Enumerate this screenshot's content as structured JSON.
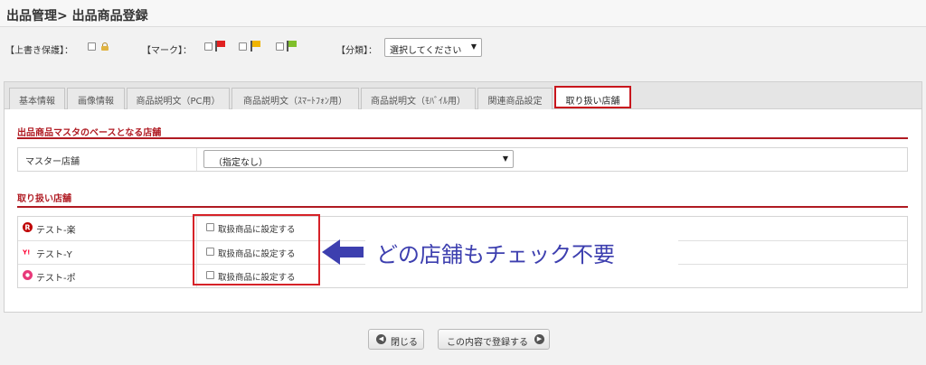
{
  "header": {
    "title": "出品管理> 出品商品登録"
  },
  "options": {
    "overwrite_label": "【上書き保護】：",
    "mark_label": "【マーク】：",
    "category_label": "【分類】：",
    "category_select_value": "選択してください",
    "flag_colors": [
      "#e02020",
      "#f0b400",
      "#7fbf2a"
    ]
  },
  "tabs": [
    {
      "label": "基本情報"
    },
    {
      "label": "画像情報"
    },
    {
      "label": "商品説明文（PC用）"
    },
    {
      "label": "商品説明文（ｽﾏｰﾄﾌｫﾝ用）"
    },
    {
      "label": "商品説明文（ﾓﾊﾞｲﾙ用）"
    },
    {
      "label": "関連商品設定"
    },
    {
      "label": "取り扱い店舗"
    }
  ],
  "master_section": {
    "title": "出品商品マスタのベースとなる店舗",
    "row_label": "マスター店舗",
    "select_value": "（指定なし）"
  },
  "stores_section": {
    "title": "取り扱い店舗",
    "stores": [
      {
        "name": "テスト-楽",
        "icon": "rakuten-icon",
        "color": "#bf0000",
        "checkbox_label": "取扱商品に設定する"
      },
      {
        "name": "テスト-Y",
        "icon": "yahoo-icon",
        "color": "#ff0033",
        "checkbox_label": "取扱商品に設定する"
      },
      {
        "name": "テスト-ポ",
        "icon": "ponpare-icon",
        "color": "#e8397a",
        "checkbox_label": "取扱商品に設定する"
      }
    ]
  },
  "annotation": {
    "text": "どの店舗もチェック不要",
    "color": "#3d3faf"
  },
  "buttons": {
    "close_label": "閉じる",
    "register_label": "この内容で登録する"
  }
}
